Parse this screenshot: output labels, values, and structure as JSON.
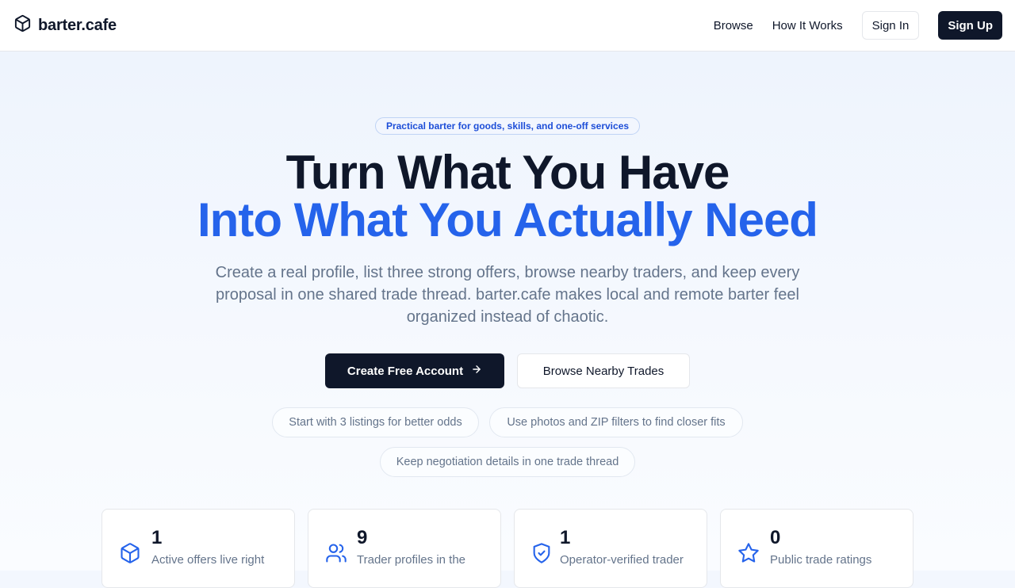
{
  "brand": {
    "name": "barter.cafe",
    "logo_icon": "box-icon"
  },
  "nav": {
    "links": [
      "Browse",
      "How It Works"
    ],
    "sign_in": "Sign In",
    "sign_up": "Sign Up"
  },
  "hero": {
    "pill": "Practical barter for goods, skills, and one-off services",
    "title_line1": "Turn What You Have",
    "title_line2": "Into What You Actually Need",
    "subtitle": "Create a real profile, list three strong offers, browse nearby traders, and keep every proposal in one shared trade thread. barter.cafe makes local and remote barter feel organized instead of chaotic.",
    "primary_cta": "Create Free Account",
    "primary_cta_icon": "arrow-right-icon",
    "secondary_cta": "Browse Nearby Trades",
    "tips": [
      "Start with 3 listings for better odds",
      "Use photos and ZIP filters to find closer fits",
      "Keep negotiation details in one trade thread"
    ]
  },
  "stats": [
    {
      "value": "1",
      "label": "Active offers live right",
      "icon": "box-icon"
    },
    {
      "value": "9",
      "label": "Trader profiles in the",
      "icon": "users-icon"
    },
    {
      "value": "1",
      "label": "Operator-verified trader",
      "icon": "shield-check-icon"
    },
    {
      "value": "0",
      "label": "Public trade ratings",
      "icon": "star-icon"
    }
  ],
  "colors": {
    "accent": "#2563eb",
    "dark": "#0f172a",
    "muted": "#64748b"
  }
}
